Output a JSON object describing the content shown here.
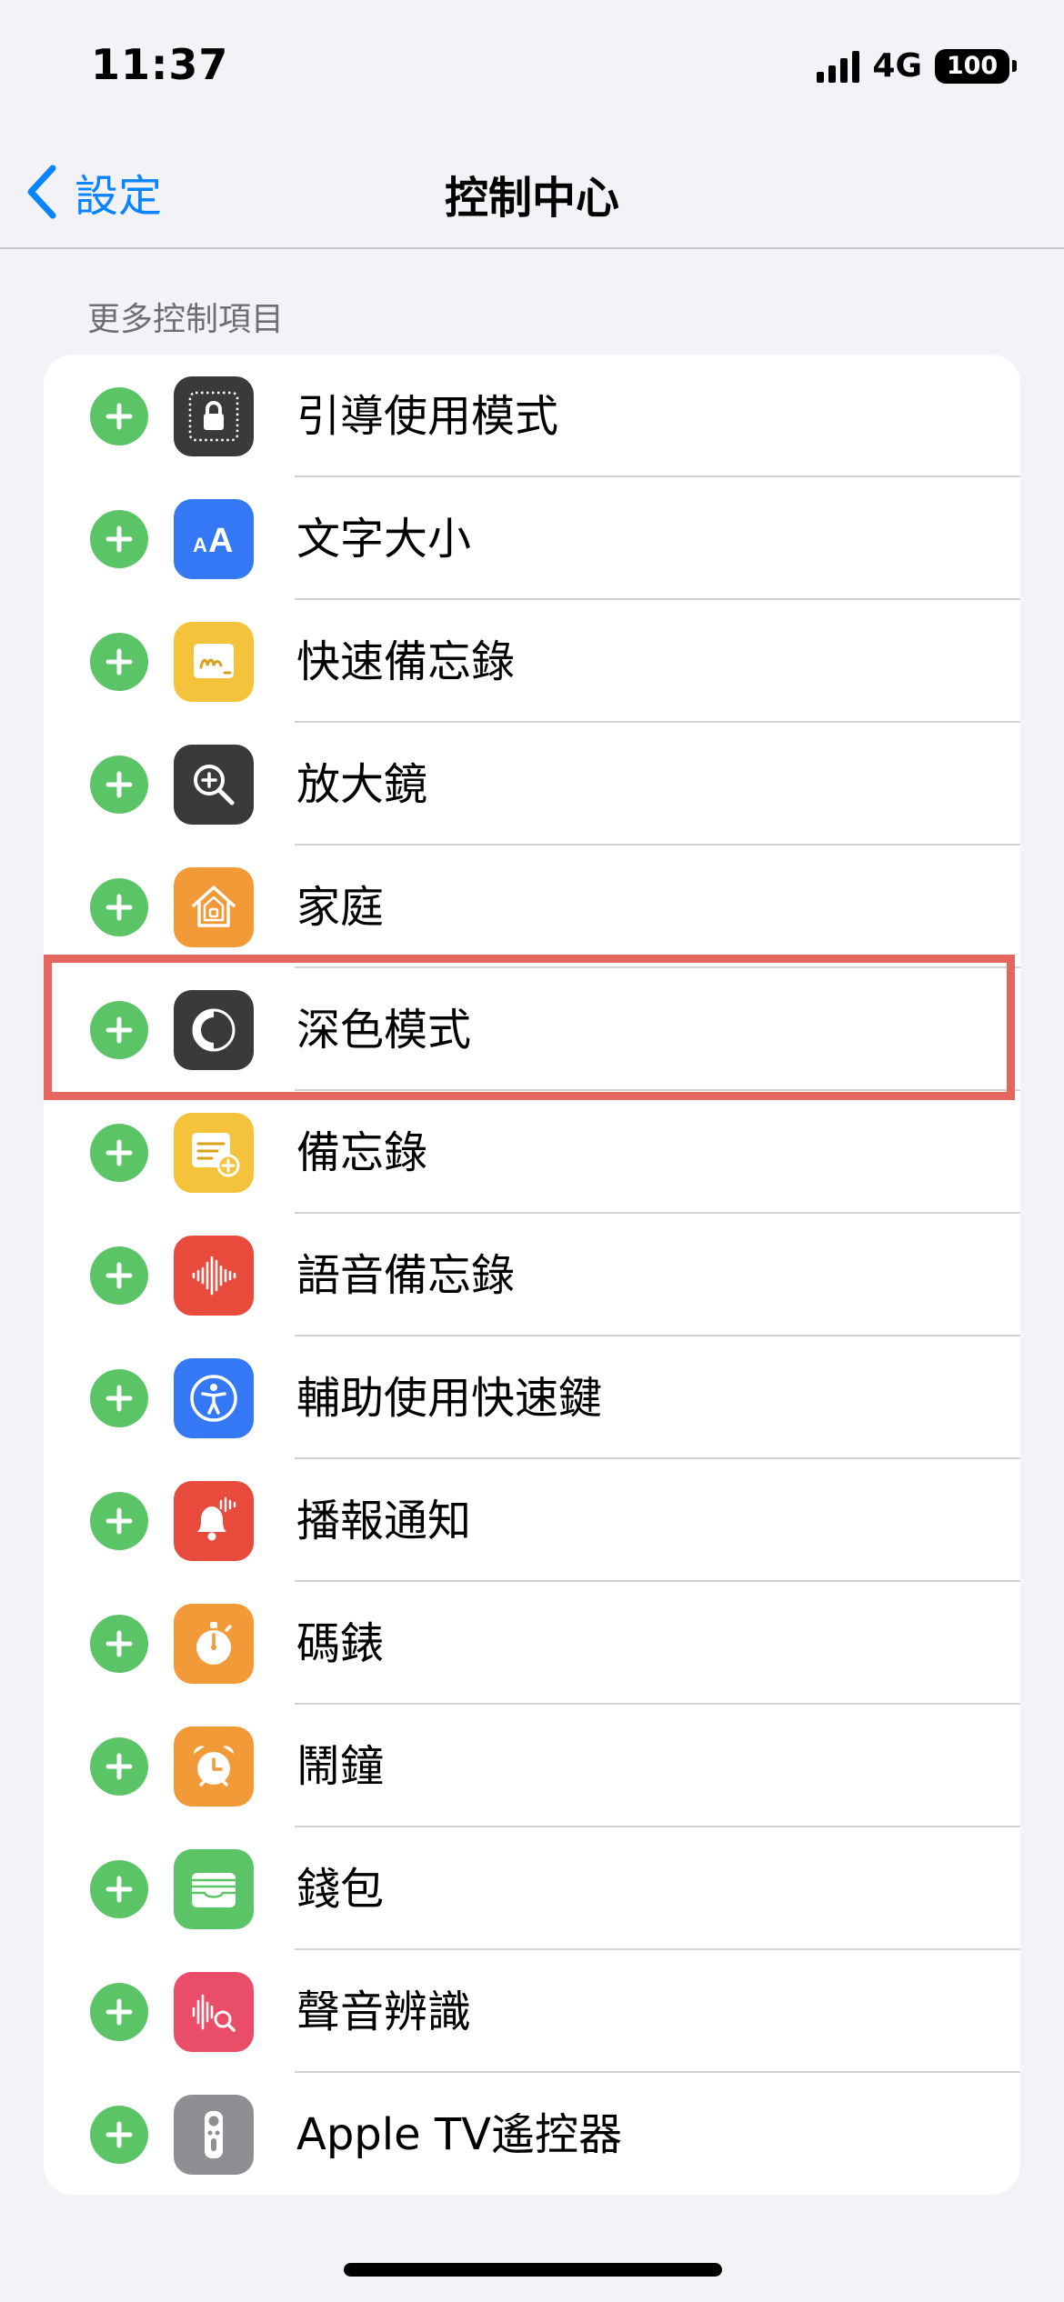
{
  "status_bar": {
    "time": "11:37",
    "network": "4G",
    "battery": "100"
  },
  "nav": {
    "back_label": "設定",
    "title": "控制中心"
  },
  "section": {
    "header": "更多控制項目"
  },
  "items": [
    {
      "label": "引導使用模式",
      "icon": "guided-access-icon",
      "color": "#3A3A3C"
    },
    {
      "label": "文字大小",
      "icon": "text-size-icon",
      "color": "#3478F6"
    },
    {
      "label": "快速備忘錄",
      "icon": "quick-note-icon",
      "color": "#F5C33B"
    },
    {
      "label": "放大鏡",
      "icon": "magnifier-icon",
      "color": "#3A3A3C"
    },
    {
      "label": "家庭",
      "icon": "home-icon",
      "color": "#F29A38"
    },
    {
      "label": "深色模式",
      "icon": "dark-mode-icon",
      "color": "#3A3A3C"
    },
    {
      "label": "備忘錄",
      "icon": "notes-icon",
      "color": "#F5C33B"
    },
    {
      "label": "語音備忘錄",
      "icon": "voice-memos-icon",
      "color": "#E84B3C"
    },
    {
      "label": "輔助使用快速鍵",
      "icon": "accessibility-icon",
      "color": "#3478F6"
    },
    {
      "label": "播報通知",
      "icon": "announce-notifications-icon",
      "color": "#E84B3C"
    },
    {
      "label": "碼錶",
      "icon": "stopwatch-icon",
      "color": "#F29A38"
    },
    {
      "label": "鬧鐘",
      "icon": "alarm-icon",
      "color": "#F29A38"
    },
    {
      "label": "錢包",
      "icon": "wallet-icon",
      "color": "#5AC467"
    },
    {
      "label": "聲音辨識",
      "icon": "sound-recognition-icon",
      "color": "#EA4D67"
    },
    {
      "label": "Apple TV遙控器",
      "icon": "apple-tv-remote-icon",
      "color": "#8E8E93"
    }
  ],
  "highlighted_item": "深色模式",
  "colors": {
    "accent": "#0A84FF",
    "add_button": "#5AC467",
    "highlight": "#E5665C",
    "background": "#F2F2F7"
  }
}
